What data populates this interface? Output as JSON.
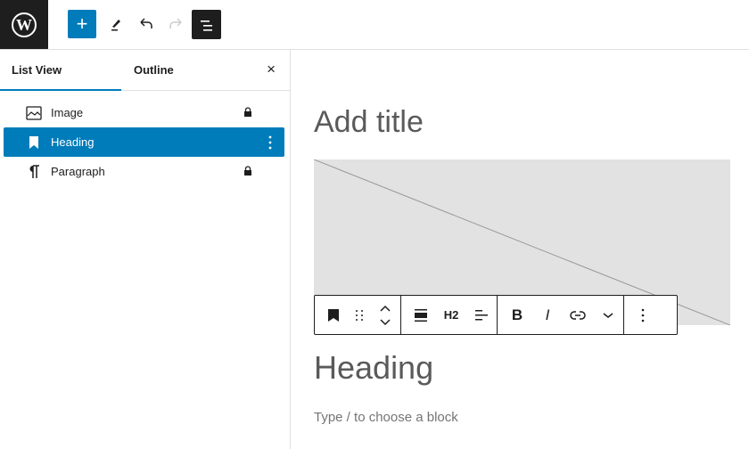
{
  "topbar": {
    "logo": "wordpress-logo",
    "add_label": "+",
    "tools": [
      "edit-icon",
      "undo-icon",
      "redo-icon",
      "list-view-icon"
    ]
  },
  "sidebar": {
    "tabs": [
      {
        "label": "List View",
        "active": true
      },
      {
        "label": "Outline",
        "active": false
      }
    ],
    "close_label": "×",
    "items": [
      {
        "label": "Image",
        "icon": "image-icon",
        "locked": true,
        "selected": false
      },
      {
        "label": "Heading",
        "icon": "bookmark-icon",
        "locked": false,
        "selected": true
      },
      {
        "label": "Paragraph",
        "icon": "paragraph-icon",
        "locked": true,
        "selected": false
      }
    ]
  },
  "canvas": {
    "title_placeholder": "Add title",
    "heading_text": "Heading",
    "paragraph_placeholder": "Type / to choose a block",
    "toolbar": {
      "level_label": "H2",
      "bold_label": "B",
      "italic_label": "I"
    }
  },
  "colors": {
    "accent": "#007cba",
    "dark": "#1e1e1e"
  }
}
